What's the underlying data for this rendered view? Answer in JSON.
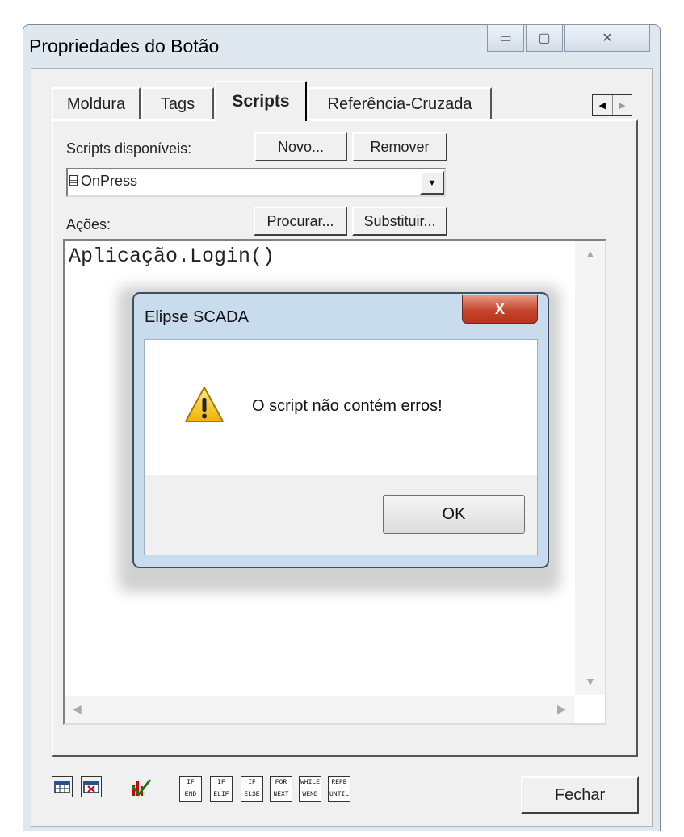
{
  "window": {
    "title": "Propriedades do Botão",
    "close_glyph": "✕",
    "maximize_glyph": "▢",
    "minimize_glyph": "▭"
  },
  "tabs": [
    {
      "label": "Moldura",
      "active": false
    },
    {
      "label": "Tags",
      "active": false
    },
    {
      "label": "Scripts",
      "active": true
    },
    {
      "label": "Referência-Cruzada",
      "active": false
    }
  ],
  "tab_scroll": {
    "left": "◀",
    "right": "▶"
  },
  "scripts": {
    "available_label": "Scripts disponíveis:",
    "new_button": "Novo...",
    "remove_button": "Remover",
    "selected_script": "OnPress",
    "actions_label": "Ações:",
    "find_button": "Procurar...",
    "replace_button": "Substituir..."
  },
  "editor": {
    "code": "Aplicação.Login()"
  },
  "dialog": {
    "title": "Elipse SCADA",
    "close_glyph": "X",
    "message": "O script não contém erros!",
    "ok_button": "OK"
  },
  "toolbar": {
    "keywords": [
      {
        "top": "IF",
        "bottom": "END"
      },
      {
        "top": "IF",
        "bottom": "ELIF"
      },
      {
        "top": "IF",
        "bottom": "ELSE"
      },
      {
        "top": "FOR",
        "bottom": "NEXT"
      },
      {
        "top": "WHILE",
        "bottom": "WEND"
      },
      {
        "top": "REPE",
        "bottom": "UNTIL"
      }
    ],
    "close_button": "Fechar"
  },
  "colors": {
    "window_frame": "#dfe7ef",
    "dialog_frame": "#c9dced",
    "close_red": "#c5452c",
    "warning_yellow": "#f5c518"
  }
}
